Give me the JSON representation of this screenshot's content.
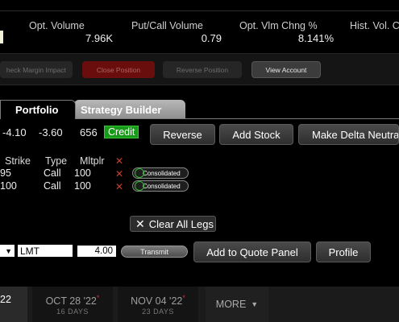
{
  "stats": {
    "items": [
      {
        "label": "Opt. Volume",
        "value": "7.96K"
      },
      {
        "label": "Put/Call Volume",
        "value": "0.79"
      },
      {
        "label": "Opt. Vlm Chng %",
        "value": "8.141%"
      },
      {
        "label": "Hist. Vol. C",
        "value": ""
      }
    ]
  },
  "actions": {
    "check_margin": "heck Margin Impact",
    "close_position": "Close Position",
    "reverse_position": "Reverse Position",
    "view_account": "View Account"
  },
  "tabs": {
    "portfolio": "Portfolio",
    "strategy_builder": "Strategy Builder"
  },
  "summary": {
    "v1": "-4.10",
    "v2": "-3.60",
    "qty": "656",
    "credit": "Credit"
  },
  "buttons": {
    "reverse": "Reverse",
    "add_stock": "Add Stock",
    "delta_neutral": "Make Delta Neutra",
    "clear_all_legs": "Clear All Legs",
    "add_to_quote_panel": "Add to Quote Panel",
    "profile": "Profile"
  },
  "legs": {
    "headers": {
      "strike": "Strike",
      "type": "Type",
      "mltplr": "Mltplr"
    },
    "rows": [
      {
        "strike": "95",
        "type": "Call",
        "mltplr": "100",
        "route": "Consolidated"
      },
      {
        "strike": "100",
        "type": "Call",
        "mltplr": "100",
        "route": "Consolidated"
      }
    ]
  },
  "order": {
    "order_type": "LMT",
    "price": "4.00",
    "transmit": "Transmit"
  },
  "expiries": {
    "first": "22",
    "items": [
      {
        "date": "OCT 28 '22",
        "days": "16 DAYS"
      },
      {
        "date": "NOV 04 '22",
        "days": "23 DAYS"
      }
    ],
    "more": "MORE"
  },
  "colors": {
    "credit_green": "#1a9a1a",
    "close_red": "#6a0d0d",
    "remove_x_red": "#cc3b2b"
  }
}
